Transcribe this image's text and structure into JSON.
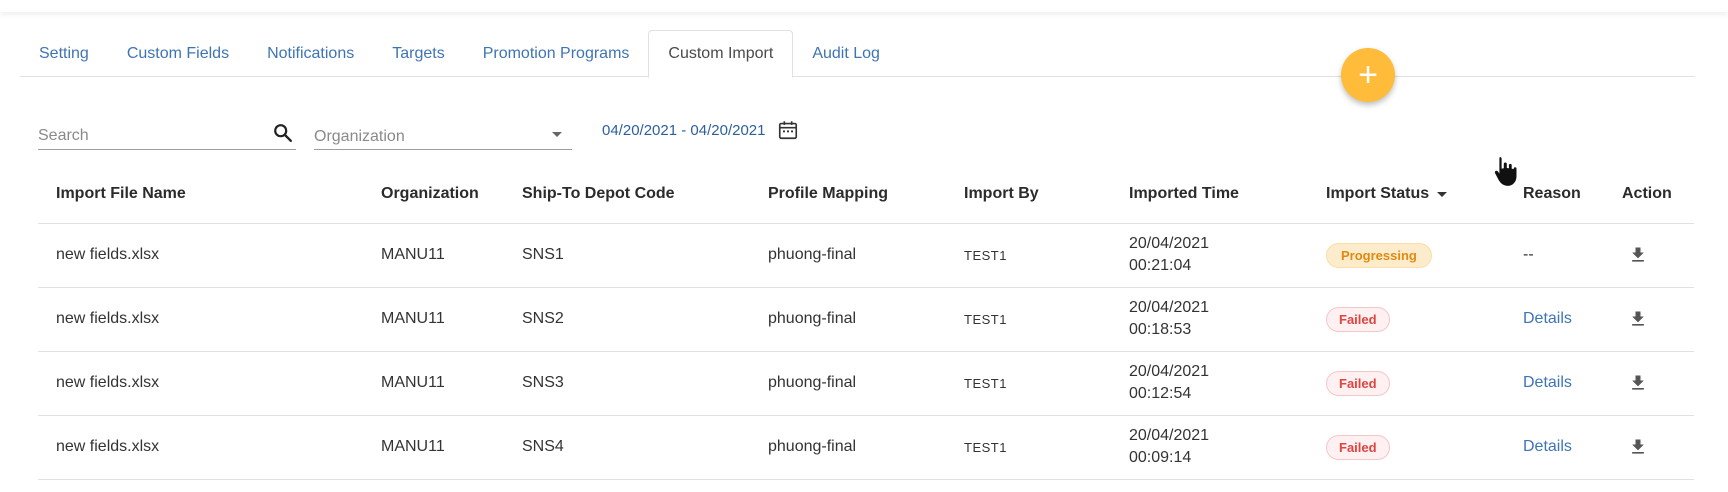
{
  "tabs": [
    {
      "label": "Setting"
    },
    {
      "label": "Custom Fields"
    },
    {
      "label": "Notifications"
    },
    {
      "label": "Targets"
    },
    {
      "label": "Promotion Programs"
    },
    {
      "label": "Custom Import"
    },
    {
      "label": "Audit Log"
    }
  ],
  "active_tab": "Custom Import",
  "fab": {
    "icon": "plus-icon",
    "label": "+",
    "color": "#ffbc3b"
  },
  "filters": {
    "search_placeholder": "Search",
    "search_icon": "search-icon",
    "organization_placeholder": "Organization",
    "date_range": "04/20/2021 - 04/20/2021",
    "calendar_icon": "calendar-icon"
  },
  "table": {
    "headers": {
      "file_name": "Import File Name",
      "organization": "Organization",
      "depot_code": "Ship-To Depot Code",
      "profile_mapping": "Profile Mapping",
      "import_by": "Import By",
      "imported_time": "Imported Time",
      "import_status": "Import Status",
      "reason": "Reason",
      "action": "Action"
    },
    "rows": [
      {
        "file_name": "new fields.xlsx",
        "organization": "MANU11",
        "depot_code": "SNS1",
        "profile_mapping": "phuong-final",
        "import_by": "TEST1",
        "date": "20/04/2021",
        "time": "00:21:04",
        "status": "Progressing",
        "reason": "--"
      },
      {
        "file_name": "new fields.xlsx",
        "organization": "MANU11",
        "depot_code": "SNS2",
        "profile_mapping": "phuong-final",
        "import_by": "TEST1",
        "date": "20/04/2021",
        "time": "00:18:53",
        "status": "Failed",
        "reason": "Details"
      },
      {
        "file_name": "new fields.xlsx",
        "organization": "MANU11",
        "depot_code": "SNS3",
        "profile_mapping": "phuong-final",
        "import_by": "TEST1",
        "date": "20/04/2021",
        "time": "00:12:54",
        "status": "Failed",
        "reason": "Details"
      },
      {
        "file_name": "new fields.xlsx",
        "organization": "MANU11",
        "depot_code": "SNS4",
        "profile_mapping": "phuong-final",
        "import_by": "TEST1",
        "date": "20/04/2021",
        "time": "00:09:14",
        "status": "Failed",
        "reason": "Details"
      }
    ]
  },
  "colors": {
    "link": "#3f74b4",
    "progressing": "#e08a12",
    "failed": "#e0443f"
  }
}
